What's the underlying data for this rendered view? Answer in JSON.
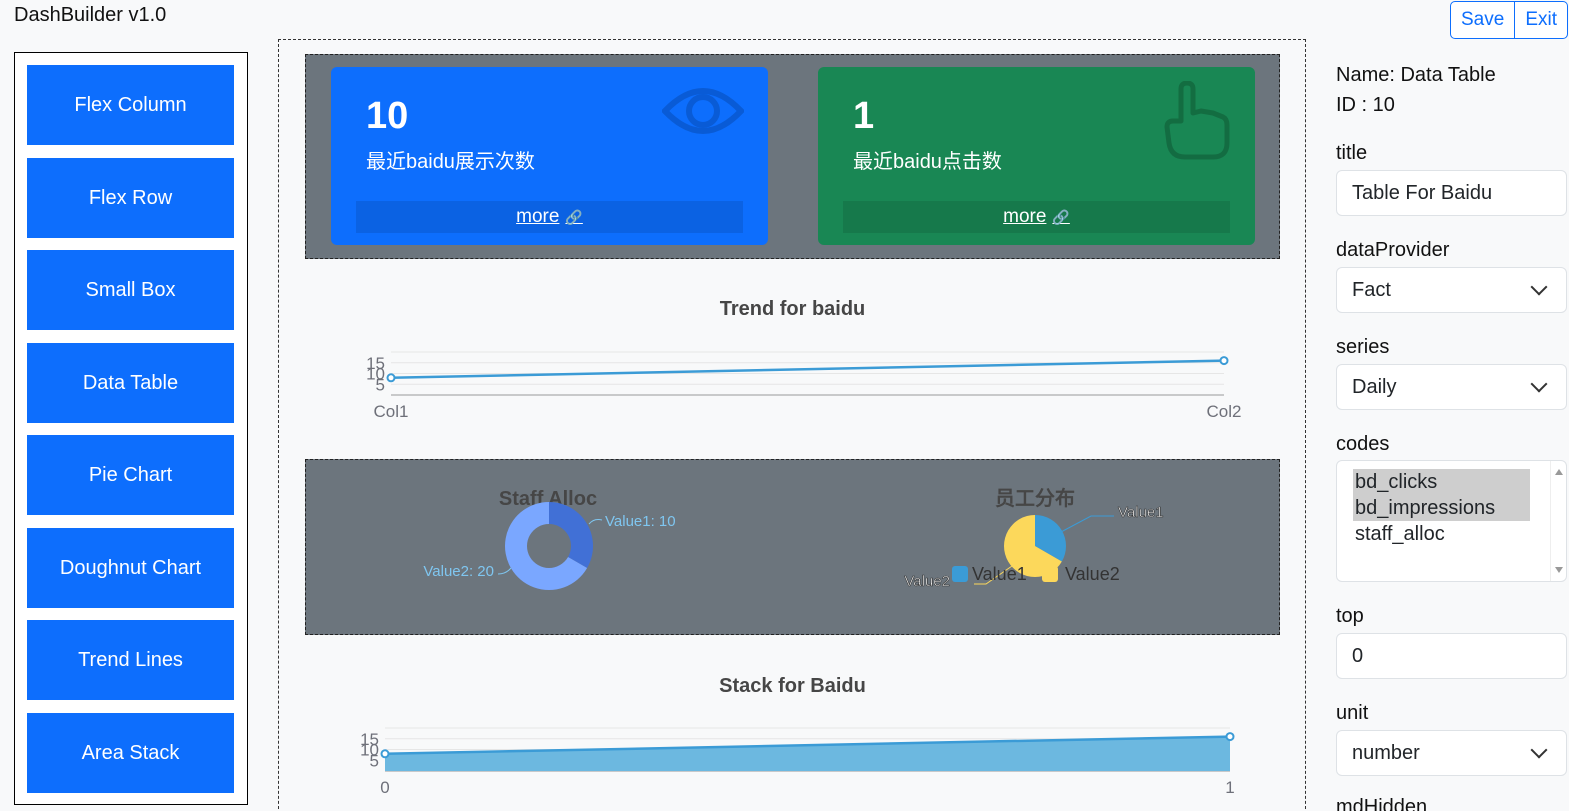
{
  "app": {
    "title": "DashBuilder v1.0"
  },
  "toolbar": {
    "save_label": "Save",
    "exit_label": "Exit"
  },
  "palette": {
    "items": [
      {
        "label": "Flex Column"
      },
      {
        "label": "Flex Row"
      },
      {
        "label": "Small Box"
      },
      {
        "label": "Data Table"
      },
      {
        "label": "Pie Chart"
      },
      {
        "label": "Doughnut Chart"
      },
      {
        "label": "Trend Lines"
      },
      {
        "label": "Area Stack"
      }
    ]
  },
  "canvas": {
    "small_boxes": [
      {
        "value": "10",
        "label": "最近baidu展示次数",
        "more": "more",
        "color": "#0d6efd",
        "icon": "eye-icon"
      },
      {
        "value": "1",
        "label": "最近baidu点击数",
        "more": "more",
        "color": "#198754",
        "icon": "hand-pointer-icon"
      }
    ]
  },
  "chart_data": [
    {
      "type": "line",
      "title": "Trend for baidu",
      "categories": [
        "Col1",
        "Col2"
      ],
      "series": [
        {
          "values": [
            8,
            16
          ]
        }
      ],
      "y_ticks": [
        "5",
        "10",
        "15"
      ],
      "color": "#3b9bd6"
    },
    {
      "type": "pie",
      "variant": "doughnut",
      "title": "Staff Alloc",
      "slices": [
        {
          "label": "Value1",
          "value": 10,
          "display": "Value1: 10",
          "color": "#4170d6"
        },
        {
          "label": "Value2",
          "value": 20,
          "display": "Value2: 20",
          "color": "#7aa7ff"
        }
      ]
    },
    {
      "type": "pie",
      "title": "员工分布",
      "slices": [
        {
          "label": "Value1",
          "value": 1,
          "color": "#3b9bd6"
        },
        {
          "label": "Value2",
          "value": 2,
          "color": "#fcd85b"
        }
      ],
      "legend": [
        "Value1",
        "Value2"
      ]
    },
    {
      "type": "area",
      "title": "Stack for Baidu",
      "categories": [
        "0",
        "1"
      ],
      "series": [
        {
          "values": [
            8,
            16
          ]
        }
      ],
      "y_ticks": [
        "5",
        "10",
        "15"
      ],
      "color": "#3b9bd6",
      "fill": "#6cb8e0"
    }
  ],
  "properties": {
    "name_line": "Name: Data Table",
    "id_line": "ID : 10",
    "title_label": "title",
    "title_value": "Table For Baidu",
    "dataProvider_label": "dataProvider",
    "dataProvider_value": "Fact",
    "series_label": "series",
    "series_value": "Daily",
    "codes_label": "codes",
    "codes": [
      {
        "label": "bd_clicks",
        "selected": true
      },
      {
        "label": "bd_impressions",
        "selected": true
      },
      {
        "label": "staff_alloc",
        "selected": false
      }
    ],
    "top_label": "top",
    "top_value": "0",
    "unit_label": "unit",
    "unit_value": "number",
    "next_label": "mdHidden"
  }
}
